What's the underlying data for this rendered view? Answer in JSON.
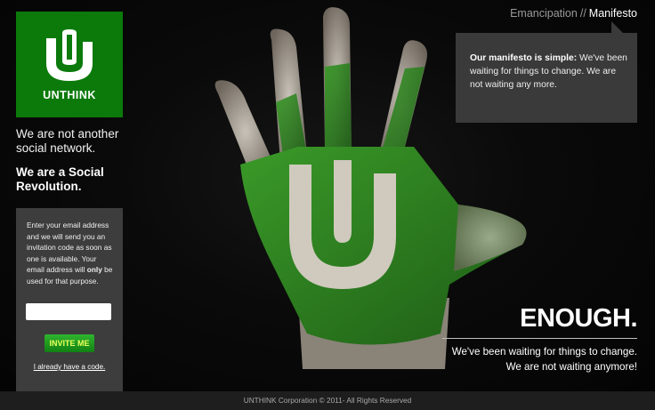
{
  "brand": {
    "name": "UNTHINK",
    "logo_icon": "unthink-u-logo-icon",
    "green": "#0b7a0b"
  },
  "taglines": {
    "line1": "We are not another social network.",
    "line2": "We are a Social Revolution."
  },
  "invite": {
    "text_before": "Enter your email address and we will send you an invitation code as soon as one is available. Your email address will ",
    "text_bold": "only",
    "text_after": " be used for that purpose.",
    "email_placeholder": "",
    "email_value": "",
    "button_label": "INVITE ME",
    "code_link": "I already have a code."
  },
  "nav": {
    "items": [
      "Emancipation",
      "Manifesto"
    ],
    "separator": "//",
    "active": "Manifesto"
  },
  "manifesto": {
    "bold": "Our manifesto is simple:",
    "text": " We've been waiting for things to change. We are not waiting any more."
  },
  "hero": {
    "headline": "ENOUGH.",
    "line1": "We've been waiting for things to change.",
    "line2": "We are not waiting anymore!"
  },
  "footer": {
    "text": "UNTHINK Corporation © 2011- All Rights Reserved"
  }
}
